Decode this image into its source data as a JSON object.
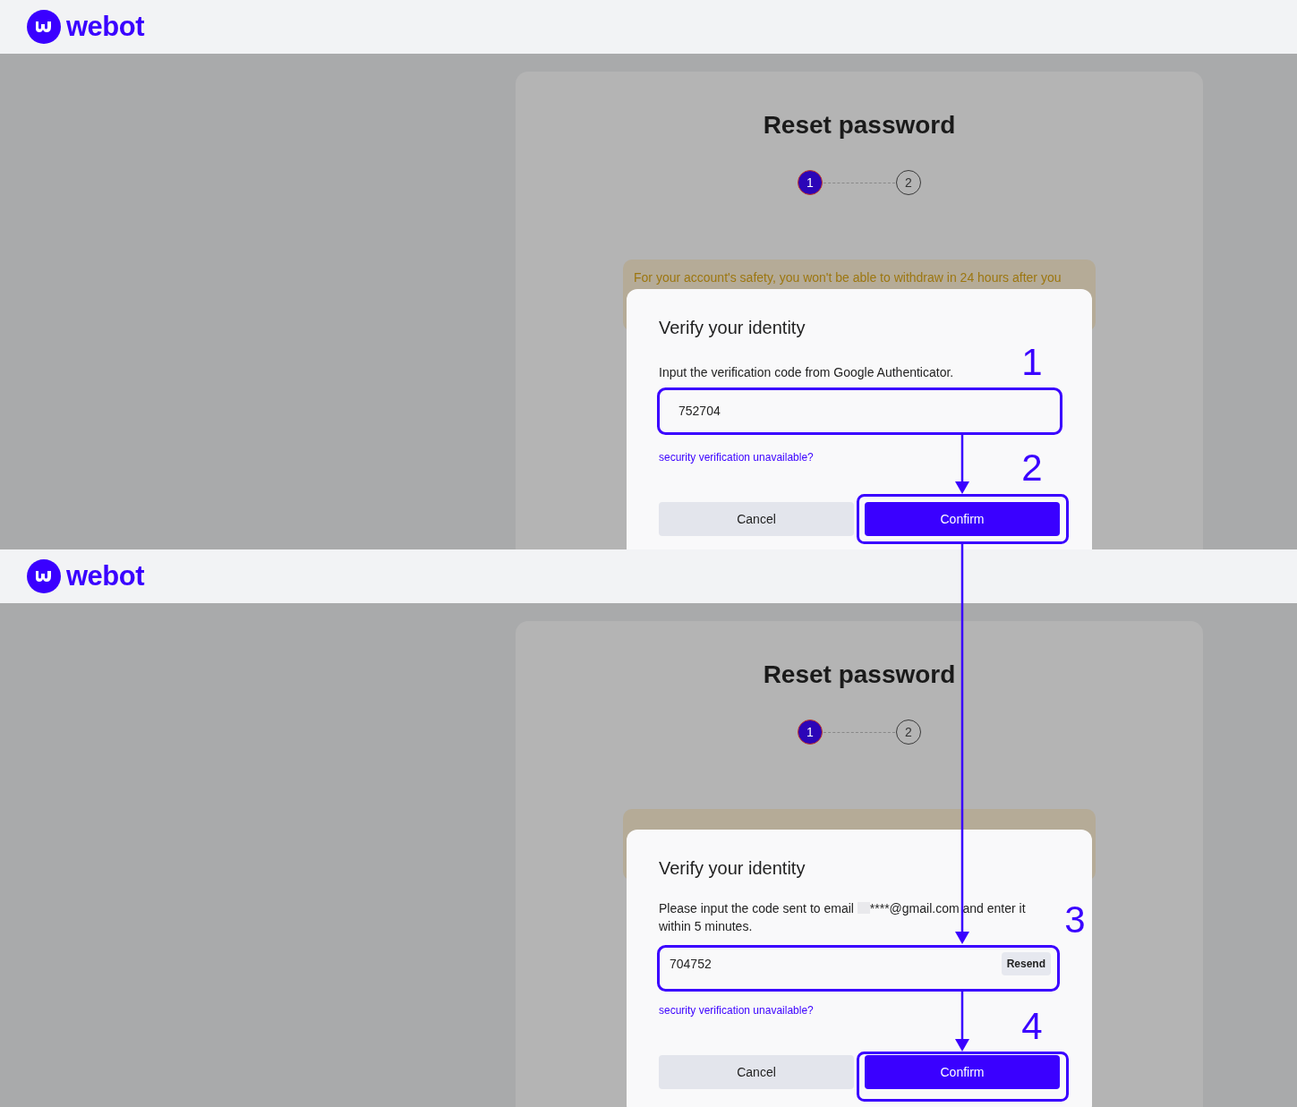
{
  "panels": [
    {
      "kind": "authenticator",
      "header": {
        "brand": "webot"
      },
      "title": "Reset password",
      "steps": [
        {
          "label": "1",
          "selected": true
        },
        {
          "label": "2",
          "selected": false
        }
      ],
      "notice": "For your account's safety, you won't be able to withdraw in 24 hours after you",
      "modal": {
        "title": "Verify your identity",
        "instruction": "Input the verification code from Google Authenticator.",
        "field": {
          "value": "752704"
        },
        "link": "security verification unavailable?",
        "cancel": "Cancel",
        "confirm": "Confirm"
      }
    },
    {
      "kind": "email",
      "header": {
        "brand": "webot"
      },
      "title": "Reset password",
      "steps": [
        {
          "label": "1",
          "selected": true
        },
        {
          "label": "2",
          "selected": false
        }
      ],
      "modal": {
        "title": "Verify your identity",
        "instruction_before": "Please input the code sent to email",
        "email": "****@gmail.com",
        "instruction_after": "and enter it within 5 minutes.",
        "field": {
          "value": "704752",
          "action": "Resend"
        },
        "link": "security verification unavailable?",
        "cancel": "Cancel",
        "confirm": "Confirm"
      }
    }
  ],
  "annotations": [
    {
      "label": "1"
    },
    {
      "label": "2"
    },
    {
      "label": "3"
    },
    {
      "label": "4"
    }
  ]
}
